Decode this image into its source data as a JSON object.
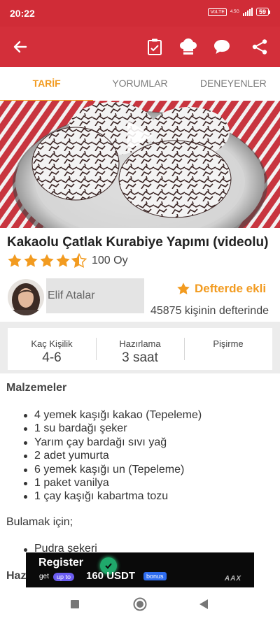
{
  "status_bar": {
    "time": "20:22",
    "volte": "VoLTE",
    "network": "4.5G",
    "battery": "59"
  },
  "app_bar": {
    "icons": [
      "back-arrow-icon",
      "checklist-icon",
      "chef-hat-icon",
      "chat-bubble-icon",
      "share-icon"
    ],
    "background": "#d32f3a"
  },
  "tabs": [
    {
      "label": "TARİF",
      "active": true
    },
    {
      "label": "YORUMLAR",
      "active": false
    },
    {
      "label": "DENEYENLER",
      "active": false
    }
  ],
  "recipe": {
    "title": "Kakaolu Çatlak Kurabiye Yapımı (videolu)",
    "rating": 4.5,
    "votes": "100 Oy"
  },
  "author": {
    "name": "Elif Atalar",
    "favorite_label": "Defterde ekli",
    "favorite_count": "45875 kişinin defterinde"
  },
  "info": [
    {
      "label": "Kaç Kişilik",
      "value": "4-6"
    },
    {
      "label": "Hazırlama",
      "value": "3 saat"
    },
    {
      "label": "Pişirme",
      "value": ""
    }
  ],
  "ingredients": {
    "title": "Malzemeler",
    "items": [
      "4 yemek kaşığı kakao (Tepeleme)",
      "1 su bardağı şeker",
      "Yarım çay bardağı sıvı yağ",
      "2 adet yumurta",
      "6 yemek kaşığı un (Tepeleme)",
      "1 paket vanilya",
      "1 çay kaşığı kabartma tozu"
    ],
    "subsection_title": "Bulamak için;",
    "subsection_items": [
      "Pudra şekeri"
    ],
    "next_section_partial": "Haz"
  },
  "ad": {
    "headline": "Register",
    "get": "get",
    "up_to": "up to",
    "amount": "160 USDT",
    "bonus": "bonus",
    "brand": "AAX"
  },
  "colors": {
    "accent": "#f29b20",
    "brand_red": "#d32f3a"
  }
}
